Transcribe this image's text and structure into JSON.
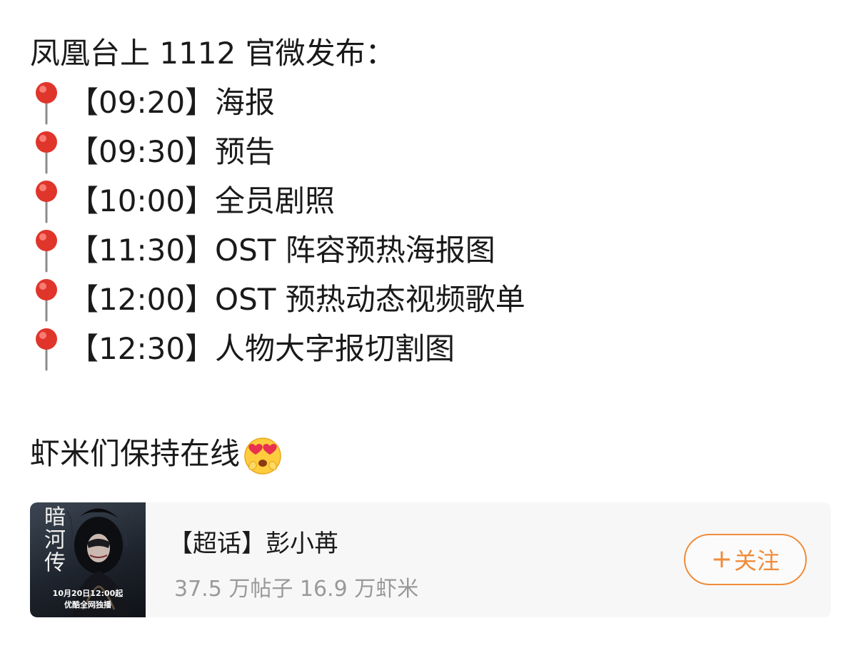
{
  "post": {
    "intro": "凤凰台上 1112 官微发布：",
    "schedule": [
      {
        "icon": "round-pushpin-icon",
        "time": "【09:20】",
        "item": "海报"
      },
      {
        "icon": "round-pushpin-icon",
        "time": "【09:30】",
        "item": "预告"
      },
      {
        "icon": "round-pushpin-icon",
        "time": "【10:00】",
        "item": "全员剧照"
      },
      {
        "icon": "round-pushpin-icon",
        "time": "【11:30】",
        "item": "OST 阵容预热海报图"
      },
      {
        "icon": "round-pushpin-icon",
        "time": "【12:00】",
        "item": "OST 预热动态视频歌单"
      },
      {
        "icon": "round-pushpin-icon",
        "time": "【12:30】",
        "item": "人物大字报切割图"
      }
    ],
    "closing": "虾米们保持在线",
    "closing_emoji": "heart-eyes-emoji-icon"
  },
  "topic_card": {
    "cover": {
      "title": "暗河传",
      "date": "10月20日12:00起",
      "platform": "优酷全网独播"
    },
    "title": "【超话】彭小苒",
    "stats": "37.5 万帖子 16.9 万虾米",
    "follow_plus": "+",
    "follow_label": "关注"
  },
  "colors": {
    "accent": "#f08c3b",
    "text": "#1a1a1a",
    "muted": "#999999",
    "card_bg": "#f7f7f7",
    "pin_red": "#e0352b"
  }
}
